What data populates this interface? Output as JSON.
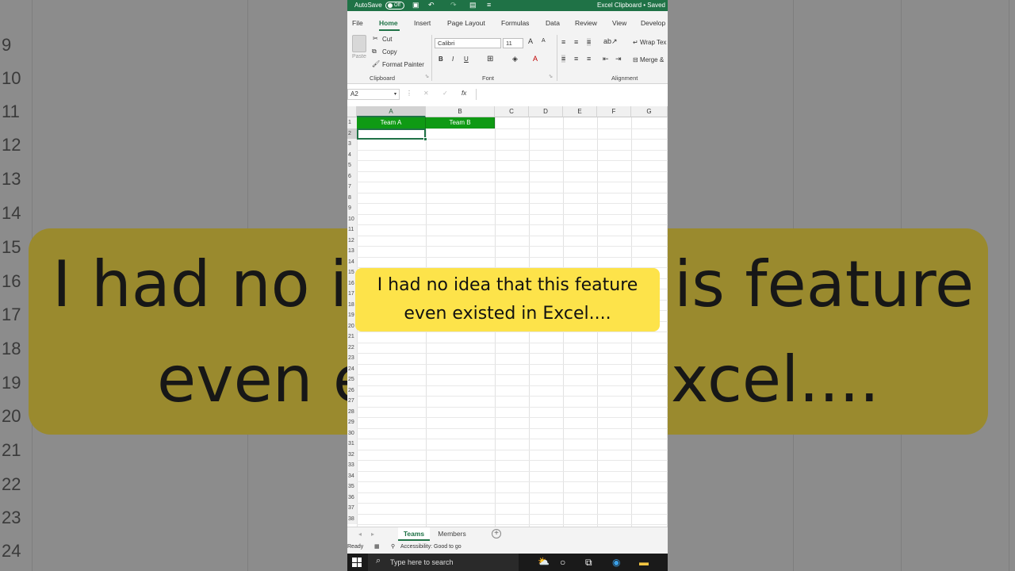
{
  "background": {
    "row_numbers": [
      "9",
      "10",
      "11",
      "12",
      "13",
      "14",
      "15",
      "16",
      "17",
      "18",
      "19",
      "20",
      "21",
      "22",
      "23",
      "24"
    ],
    "caption_left_line1": "I had no ic",
    "caption_right_line1": "is feature",
    "caption_left_line2": "even e",
    "caption_right_line2": "xcel...."
  },
  "titlebar": {
    "autosave_label": "AutoSave",
    "autosave_state": "Off",
    "document_title": "Excel Clipboard • Saved",
    "save_icon": "save-icon",
    "undo_icon": "undo-icon",
    "redo_icon": "redo-icon"
  },
  "ribbon_tabs": [
    "File",
    "Home",
    "Insert",
    "Page Layout",
    "Formulas",
    "Data",
    "Review",
    "View",
    "Develop"
  ],
  "ribbon": {
    "clipboard": {
      "paste": "Paste",
      "cut": "Cut",
      "copy": "Copy",
      "format_painter": "Format Painter",
      "group": "Clipboard"
    },
    "font": {
      "name": "Calibri",
      "size": "11",
      "bold": "B",
      "italic": "I",
      "underline": "U",
      "group": "Font"
    },
    "alignment": {
      "wrap": "Wrap Tex",
      "merge": "Merge &",
      "group": "Alignment"
    },
    "accent_color": "#1f7246",
    "font_color": "#c00000"
  },
  "formula_bar": {
    "name_box": "A2",
    "cancel": "✕",
    "enter": "✓",
    "fx": "fx",
    "content": ""
  },
  "grid": {
    "columns": [
      "A",
      "B",
      "C",
      "D",
      "E",
      "F",
      "G"
    ],
    "rows": [
      "1",
      "2",
      "3",
      "4",
      "5",
      "6",
      "7",
      "8",
      "9",
      "10",
      "11",
      "12",
      "13",
      "14",
      "15",
      "16",
      "17",
      "18",
      "19",
      "20",
      "21",
      "22",
      "23",
      "24",
      "25",
      "26",
      "27",
      "28",
      "29",
      "30",
      "31",
      "32",
      "33",
      "34",
      "35",
      "36",
      "37",
      "38"
    ],
    "header_cells": [
      "Team A",
      "Team B"
    ],
    "header_fill": "#0f9a14",
    "active_cell": "A2"
  },
  "caption": {
    "line1": "I had no idea that this feature",
    "line2": "even existed in Excel....",
    "color": "#fde34a"
  },
  "sheets": {
    "tabs": [
      "Teams",
      "Members"
    ],
    "active": "Teams"
  },
  "status": {
    "ready": "Ready",
    "accessibility": "Accessibility: Good to go"
  },
  "taskbar": {
    "search_placeholder": "Type here to search"
  }
}
